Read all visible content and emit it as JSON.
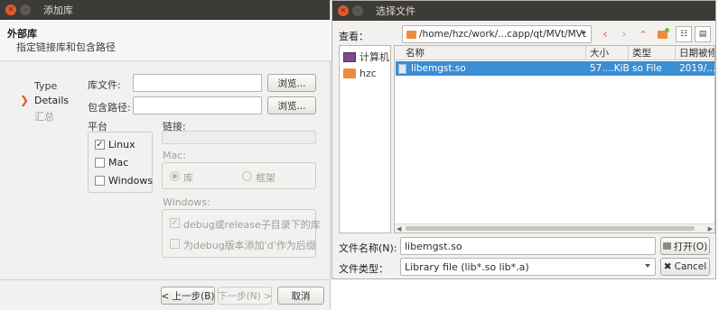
{
  "add_library": {
    "title": "添加库",
    "header_title": "外部库",
    "header_subtitle": "指定链接库和包含路径",
    "steps": [
      "Type",
      "Details",
      "汇总"
    ],
    "library_file_label": "库文件:",
    "include_path_label": "包含路径:",
    "browse_label": "浏览...",
    "platform_label": "平台",
    "platforms": [
      {
        "label": "Linux",
        "checked": true
      },
      {
        "label": "Mac",
        "checked": false
      },
      {
        "label": "Windows",
        "checked": false
      }
    ],
    "linkage_label": "链接:",
    "mac_label": "Mac:",
    "mac_library_option": "库",
    "mac_framework_option": "框架",
    "windows_label": "Windows:",
    "debug_release_label": "debug或release子目录下的库",
    "debug_suffix_label": "为debug版本添加'd'作为后缀",
    "back_button": "< 上一步(B)",
    "next_button": "下一步(N) >",
    "cancel_button": "取消"
  },
  "file_dialog": {
    "title": "选择文件",
    "look_in_label": "查看：",
    "look_in_path": "/home/hzc/work/...capp/qt/MVt/MVt",
    "sidebar": [
      {
        "label": "计算机",
        "icon": "computer-icon"
      },
      {
        "label": "hzc",
        "icon": "folder-icon"
      }
    ],
    "columns": [
      "名称",
      "大小",
      "类型",
      "日期被修"
    ],
    "files": [
      {
        "name": "libemgst.so",
        "size": "57....KiB",
        "type": "so File",
        "date": "2019/..."
      }
    ],
    "file_name_label": "文件名称(N):",
    "file_name_value": "libemgst.so",
    "file_type_label": "文件类型：",
    "file_type_value": "Library file (lib*.so lib*.a)",
    "open_button": "打开(O)",
    "cancel_button": "Cancel",
    "colors": {
      "selection": "#3a8ed4",
      "accent": "#e95420",
      "folder": "#f08a3c"
    }
  }
}
